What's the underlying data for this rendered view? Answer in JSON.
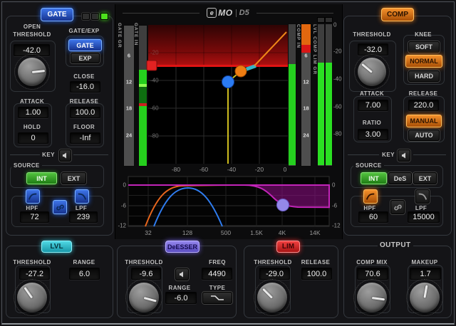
{
  "logo": {
    "emo_e": "e",
    "emo_mo": "MO",
    "d5": "D5"
  },
  "gate": {
    "header": "GATE",
    "open_l1": "OPEN",
    "open_l2": "THRESHOLD",
    "open_value": "-42.0",
    "mode_label": "GATE/EXP",
    "mode_gate": "GATE",
    "mode_exp": "EXP",
    "close_label": "CLOSE",
    "close_value": "-16.0",
    "attack_label": "ATTACK",
    "attack_value": "1.00",
    "release_label": "RELEASE",
    "release_value": "100.0",
    "hold_label": "HOLD",
    "hold_value": "0",
    "floor_label": "FLOOR",
    "floor_value": "-Inf",
    "key_label": "KEY",
    "source_label": "SOURCE",
    "int": "INT",
    "ext": "EXT",
    "hpf_label": "HPF",
    "hpf_value": "72",
    "lpf_label": "LPF",
    "lpf_value": "239"
  },
  "comp": {
    "header": "COMP",
    "threshold_label": "THRESHOLD",
    "threshold_value": "-32.0",
    "knee_label": "KNEE",
    "knee_soft": "SOFT",
    "knee_normal": "NORMAL",
    "knee_hard": "HARD",
    "attack_label": "ATTACK",
    "attack_value": "7.00",
    "release_label": "RELEASE",
    "release_value": "220.0",
    "ratio_label": "RATIO",
    "ratio_value": "3.00",
    "rel_manual": "MANUAL",
    "rel_auto": "AUTO",
    "key_label": "KEY",
    "source_label": "SOURCE",
    "int": "INT",
    "des": "DeS",
    "ext": "EXT",
    "hpf_label": "HPF",
    "hpf_value": "60",
    "lpf_label": "LPF",
    "lpf_value": "15000"
  },
  "meters": {
    "gate_gr_label": "GATE GR",
    "gate_in_label": "GATE IN",
    "comp_in_label": "COMP IN",
    "gr_label": "LVL COMP LIM GR",
    "gr_ticks": [
      "6",
      "12",
      "18",
      "24"
    ],
    "out_scale": [
      "0",
      "-20",
      "-40",
      "-60",
      "-80"
    ]
  },
  "graph": {
    "x_ticks": [
      "-80",
      "-60",
      "-40",
      "-20",
      "0"
    ],
    "y_ticks": [
      "-20",
      "-40",
      "-60",
      "-80"
    ]
  },
  "eq": {
    "x_ticks": [
      "32",
      "128",
      "500",
      "1.5K",
      "4K",
      "14K"
    ],
    "y_ticks": [
      "0",
      "-6",
      "-12"
    ]
  },
  "lvl": {
    "header": "LVL",
    "threshold_label": "THRESHOLD",
    "threshold_value": "-27.2",
    "range_label": "RANGE",
    "range_value": "6.0"
  },
  "deesser": {
    "header": "DeESSER",
    "threshold_label": "THRESHOLD",
    "threshold_value": "-9.6",
    "freq_label": "FREQ",
    "freq_value": "4490",
    "range_label": "RANGE",
    "range_value": "-6.0",
    "type_label": "TYPE"
  },
  "lim": {
    "header": "LIM",
    "threshold_label": "THRESHOLD",
    "threshold_value": "-29.0",
    "release_label": "RELEASE",
    "release_value": "100.0"
  },
  "output": {
    "header": "OUTPUT",
    "comp_mix_label": "COMP MIX",
    "comp_mix_value": "70.6",
    "makeup_label": "MAKEUP",
    "makeup_value": "1.7"
  }
}
